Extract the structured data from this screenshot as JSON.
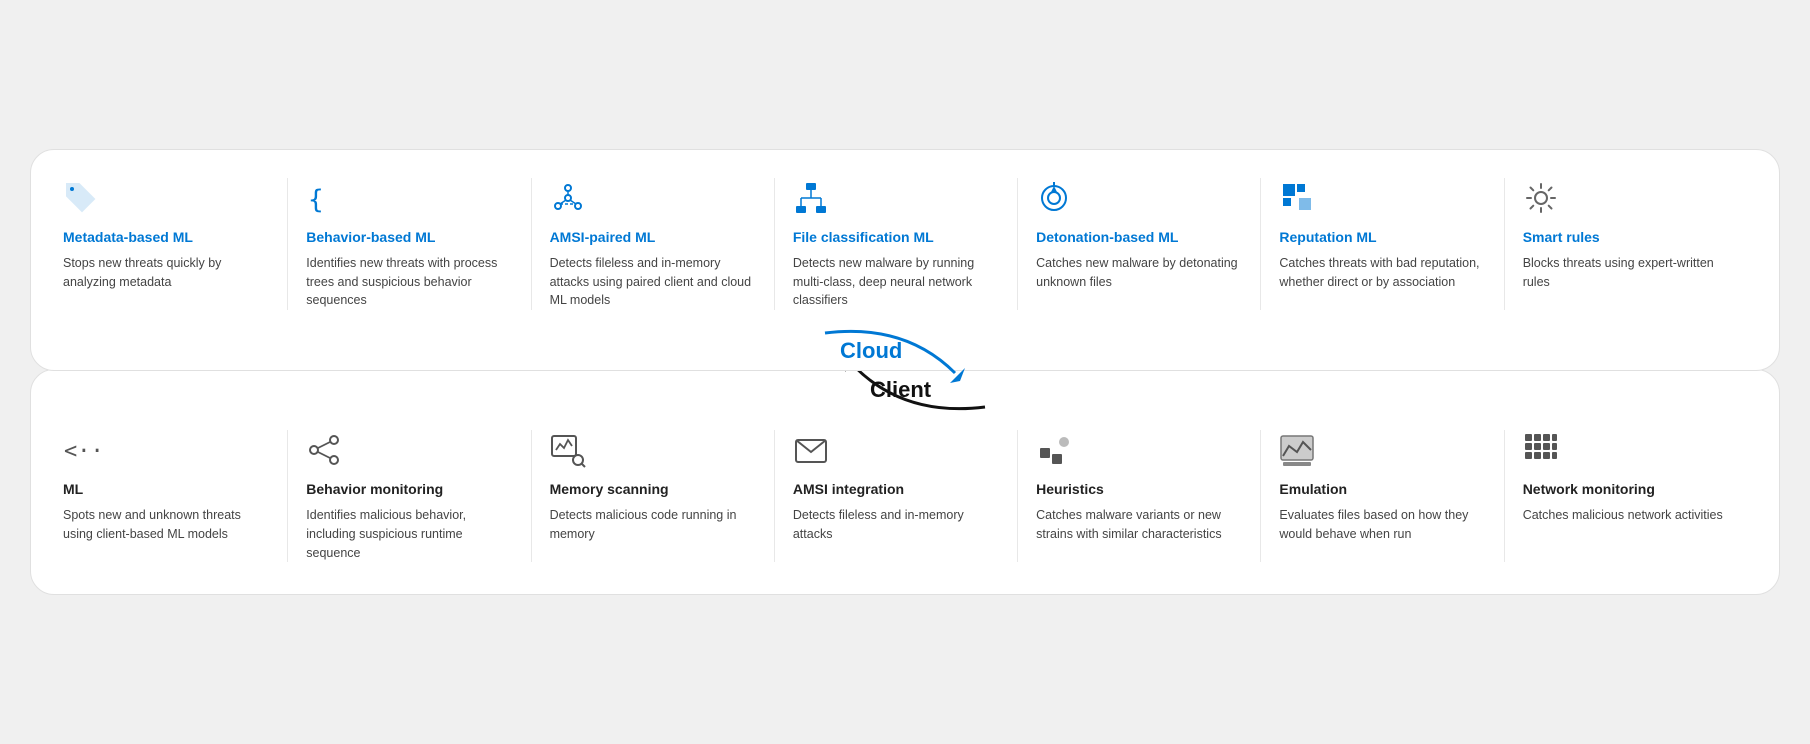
{
  "cloud": {
    "label": "Cloud",
    "items": [
      {
        "id": "metadata-ml",
        "title": "Metadata-based ML",
        "desc": "Stops new threats quickly by analyzing metadata",
        "icon": "tag"
      },
      {
        "id": "behavior-ml",
        "title": "Behavior-based ML",
        "desc": "Identifies new threats with process trees and suspicious behavior sequences",
        "icon": "braces"
      },
      {
        "id": "amsi-ml",
        "title": "AMSI-paired ML",
        "desc": "Detects fileless and in-memory attacks using paired client and cloud ML models",
        "icon": "network"
      },
      {
        "id": "file-ml",
        "title": "File classification ML",
        "desc": "Detects new malware by running multi-class, deep neural network classifiers",
        "icon": "hierarchy"
      },
      {
        "id": "detonation-ml",
        "title": "Detonation-based ML",
        "desc": "Catches new malware by detonating unknown files",
        "icon": "crosshair"
      },
      {
        "id": "reputation-ml",
        "title": "Reputation ML",
        "desc": "Catches threats with bad reputation, whether direct or by association",
        "icon": "grid-squares"
      },
      {
        "id": "smart-rules",
        "title": "Smart rules",
        "desc": "Blocks threats using expert-written rules",
        "icon": "gear"
      }
    ]
  },
  "client": {
    "label": "Client",
    "items": [
      {
        "id": "client-ml",
        "title": "ML",
        "desc": "Spots new and unknown threats using client-based ML models",
        "icon": "arrows-lr"
      },
      {
        "id": "behavior-monitoring",
        "title": "Behavior monitoring",
        "desc": "Identifies malicious behavior, including suspicious runtime sequence",
        "icon": "share"
      },
      {
        "id": "memory-scanning",
        "title": "Memory scanning",
        "desc": "Detects malicious code running in memory",
        "icon": "chart-search"
      },
      {
        "id": "amsi-integration",
        "title": "AMSI integration",
        "desc": "Detects fileless and in-memory attacks",
        "icon": "envelope"
      },
      {
        "id": "heuristics",
        "title": "Heuristics",
        "desc": "Catches malware variants or new strains with similar characteristics",
        "icon": "dots-square"
      },
      {
        "id": "emulation",
        "title": "Emulation",
        "desc": "Evaluates files based on how they would behave when run",
        "icon": "mountain-chart"
      },
      {
        "id": "network-monitoring",
        "title": "Network monitoring",
        "desc": "Catches malicious network activities",
        "icon": "grid-blocks"
      }
    ]
  }
}
